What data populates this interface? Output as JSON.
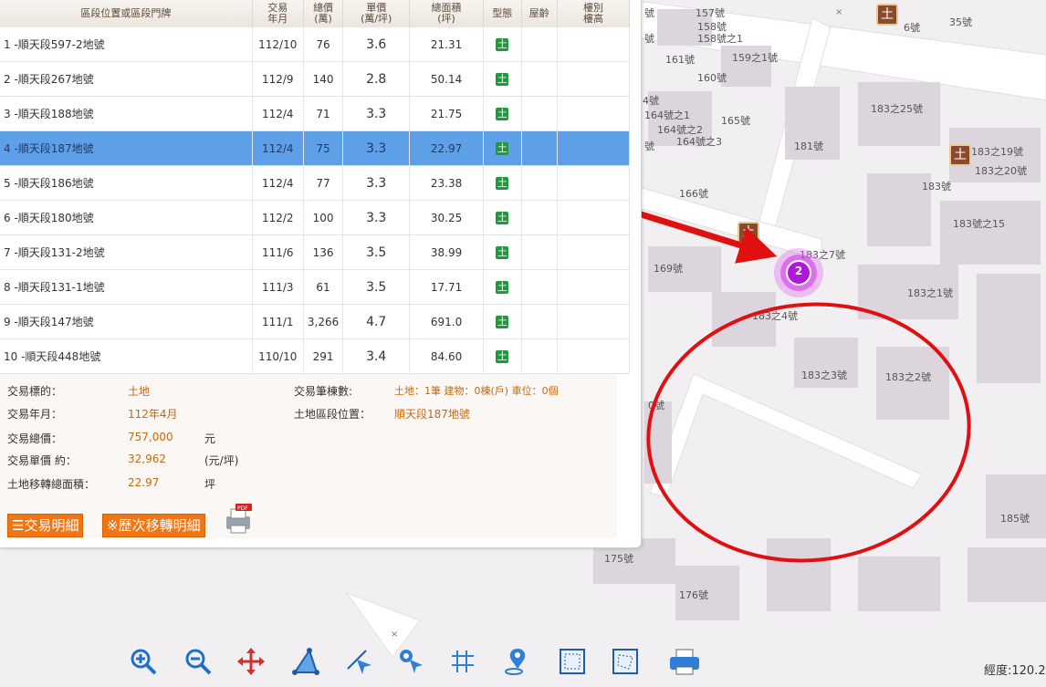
{
  "table": {
    "headers": {
      "location": "區段位置或區段門牌",
      "date": [
        "交易",
        "年月"
      ],
      "total": [
        "總價",
        "(萬)"
      ],
      "unit": [
        "單價",
        "(萬/坪)"
      ],
      "area": [
        "總面積",
        "(坪)"
      ],
      "type": "型態",
      "age": "屋齡",
      "floor": [
        "樓別",
        "樓高"
      ]
    },
    "rows": [
      {
        "location": "1 -順天段597-2地號",
        "date": "112/10",
        "total": "76",
        "unit": "3.6",
        "area": "21.31",
        "type": "土"
      },
      {
        "location": "2 -順天段267地號",
        "date": "112/9",
        "total": "140",
        "unit": "2.8",
        "area": "50.14",
        "type": "土"
      },
      {
        "location": "3 -順天段188地號",
        "date": "112/4",
        "total": "71",
        "unit": "3.3",
        "area": "21.75",
        "type": "土"
      },
      {
        "location": "4 -順天段187地號",
        "date": "112/4",
        "total": "75",
        "unit": "3.3",
        "area": "22.97",
        "type": "土"
      },
      {
        "location": "5 -順天段186地號",
        "date": "112/4",
        "total": "77",
        "unit": "3.3",
        "area": "23.38",
        "type": "土"
      },
      {
        "location": "6 -順天段180地號",
        "date": "112/2",
        "total": "100",
        "unit": "3.3",
        "area": "30.25",
        "type": "土"
      },
      {
        "location": "7 -順天段131-2地號",
        "date": "111/6",
        "total": "136",
        "unit": "3.5",
        "area": "38.99",
        "type": "土"
      },
      {
        "location": "8 -順天段131-1地號",
        "date": "111/3",
        "total": "61",
        "unit": "3.5",
        "area": "17.71",
        "type": "土"
      },
      {
        "location": "9 -順天段147地號",
        "date": "111/1",
        "total": "3,266",
        "unit": "4.7",
        "area": "691.0",
        "type": "土"
      },
      {
        "location": "10 -順天段448地號",
        "date": "110/10",
        "total": "291",
        "unit": "3.4",
        "area": "84.60",
        "type": "土"
      }
    ]
  },
  "detail": {
    "target_label": "交易標的：",
    "target_value": "土地",
    "date_label": "交易年月：",
    "date_value": "112年4月",
    "total_label": "交易總價：",
    "total_value": "757,000",
    "total_unit": "元",
    "unit_label": "交易單價 約：",
    "unit_value": "32,962",
    "unit_unit": "(元/坪)",
    "area_label": "土地移轉總面積：",
    "area_value": "22.97",
    "area_unit": "坪",
    "count_label": "交易筆棟數:",
    "count_value": "土地：1筆 建物：0棟(戶) 車位：0個",
    "loc_label": "土地區段位置：",
    "loc_value": "順天段187地號"
  },
  "buttons": {
    "detail": "交易明細",
    "history": "※歷次移轉明細"
  },
  "map": {
    "cluster_count": "2",
    "addresses": [
      "157號",
      "158號",
      "158號之1",
      "161號",
      "159之1號",
      "160號",
      "164號之1",
      "165號",
      "164號之2",
      "164號之3",
      "181號",
      "183之25號",
      "166號",
      "183之19號",
      "183之20號",
      "183號",
      "183號之15",
      "183之7號",
      "169號",
      "183之1號",
      "183之4號",
      "183之3號",
      "183之2號",
      "185號",
      "175號",
      "176號",
      "35號",
      "6號",
      "4號",
      "0號",
      "號",
      "號",
      "號"
    ]
  },
  "toolbar": {
    "icons": [
      "zoom-in-icon",
      "zoom-out-icon",
      "pan-icon",
      "measure-area-icon",
      "measure-distance-icon",
      "identify-icon",
      "parcel-icon",
      "locate-icon",
      "select-rect-icon",
      "select-poly-icon",
      "print-icon"
    ]
  },
  "coord": "經度:120.2",
  "colors": {
    "selected_row": "#5ea0e8",
    "accent_orange": "#f07514",
    "land_badge": "#1f9a3a",
    "annotation_red": "#e01010",
    "cluster": "#c020e0"
  }
}
